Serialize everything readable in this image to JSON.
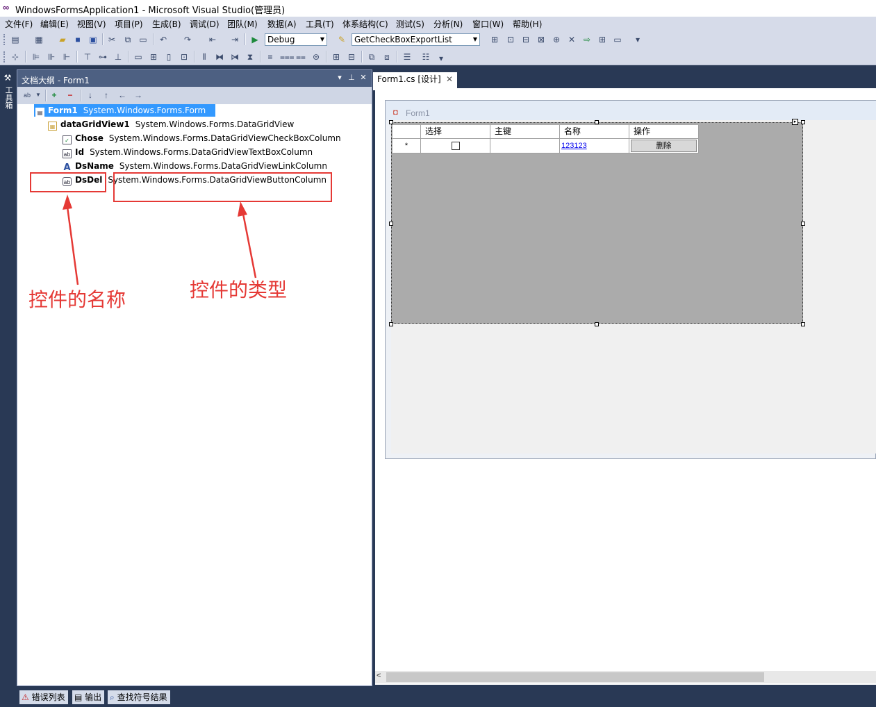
{
  "window": {
    "title": "WindowsFormsApplication1 - Microsoft Visual Studio(管理员)"
  },
  "menu": [
    "文件(F)",
    "编辑(E)",
    "视图(V)",
    "项目(P)",
    "生成(B)",
    "调试(D)",
    "团队(M)",
    "数据(A)",
    "工具(T)",
    "体系结构(C)",
    "测试(S)",
    "分析(N)",
    "窗口(W)",
    "帮助(H)"
  ],
  "toolbar": {
    "config": "Debug",
    "target": "GetCheckBoxExportList"
  },
  "left_tab": {
    "label": "工具箱"
  },
  "outline": {
    "title": "文档大纲 - Form1",
    "nodes": [
      {
        "name": "Form1",
        "type": "System.Windows.Forms.Form",
        "icon": "form-icon"
      },
      {
        "name": "dataGridView1",
        "type": "System.Windows.Forms.DataGridView",
        "icon": "grid-icon"
      },
      {
        "name": "Chose",
        "type": "System.Windows.Forms.DataGridViewCheckBoxColumn",
        "icon": "checkbox-icon"
      },
      {
        "name": "Id",
        "type": "System.Windows.Forms.DataGridViewTextBoxColumn",
        "icon": "textbox-icon"
      },
      {
        "name": "DsName",
        "type": "System.Windows.Forms.DataGridViewLinkColumn",
        "icon": "link-icon"
      },
      {
        "name": "DsDel",
        "type": "System.Windows.Forms.DataGridViewButtonColumn",
        "icon": "button-icon"
      }
    ]
  },
  "annotations": {
    "name_label": "控件的名称",
    "type_label": "控件的类型"
  },
  "doc_tab": {
    "label": "Form1.cs [设计]"
  },
  "form": {
    "title": "Form1",
    "grid": {
      "columns": [
        "选择",
        "主键",
        "名称",
        "操作"
      ],
      "new_row": {
        "marker": "*",
        "link": "123123",
        "button": "删除"
      }
    }
  },
  "status_tabs": [
    "错误列表",
    "输出",
    "查找符号结果"
  ],
  "colors": {
    "chrome": "#293955",
    "header": "#4d6082",
    "selection": "#3399ff",
    "annotation": "#e53935"
  }
}
